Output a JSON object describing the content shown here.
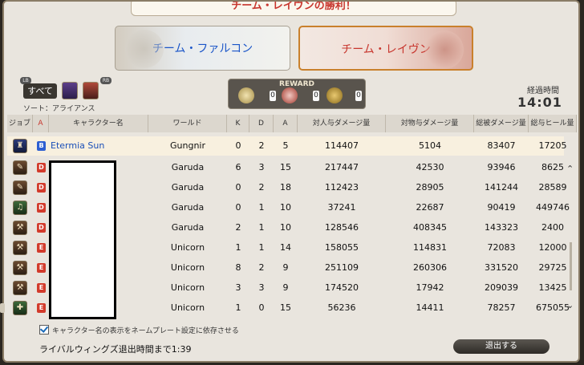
{
  "banner": {
    "title": "チーム・レイヴンの勝利！"
  },
  "teams": {
    "falcon": "チーム・ファルコン",
    "raven": "チーム・レイヴン"
  },
  "filter": {
    "lb": "LB",
    "rb": "RB",
    "all": "すべて",
    "sort": "ソート：アライアンス"
  },
  "reward": {
    "title": "REWARD",
    "values": [
      "0",
      "0",
      "0"
    ]
  },
  "elapsed": {
    "label": "経過時間",
    "time": "14:01"
  },
  "table": {
    "headers": [
      "ジョブ",
      "A",
      "キャラクター名",
      "ワールド",
      "K",
      "D",
      "A",
      "対人与ダメージ量",
      "対物与ダメージ量",
      "総被ダメージ量",
      "総与ヒール量"
    ],
    "rows": [
      {
        "team": "B",
        "name": "Etermia Sun",
        "world": "Gungnir",
        "k": "0",
        "d": "2",
        "a": "5",
        "pvp": "114407",
        "obj": "5104",
        "taken": "83407",
        "heal": "17205"
      },
      {
        "team": "D",
        "name": "",
        "world": "Garuda",
        "k": "6",
        "d": "3",
        "a": "15",
        "pvp": "217447",
        "obj": "42530",
        "taken": "93946",
        "heal": "8625"
      },
      {
        "team": "D",
        "name": "",
        "world": "Garuda",
        "k": "0",
        "d": "2",
        "a": "18",
        "pvp": "112423",
        "obj": "28905",
        "taken": "141244",
        "heal": "28589"
      },
      {
        "team": "D",
        "name": "",
        "world": "Garuda",
        "k": "0",
        "d": "1",
        "a": "10",
        "pvp": "37241",
        "obj": "22687",
        "taken": "90419",
        "heal": "449746"
      },
      {
        "team": "D",
        "name": "",
        "world": "Garuda",
        "k": "2",
        "d": "1",
        "a": "10",
        "pvp": "128546",
        "obj": "408345",
        "taken": "143323",
        "heal": "2400"
      },
      {
        "team": "E",
        "name": "",
        "world": "Unicorn",
        "k": "1",
        "d": "1",
        "a": "14",
        "pvp": "158055",
        "obj": "114831",
        "taken": "72083",
        "heal": "12000"
      },
      {
        "team": "E",
        "name": "",
        "world": "Unicorn",
        "k": "8",
        "d": "2",
        "a": "9",
        "pvp": "251109",
        "obj": "260306",
        "taken": "331520",
        "heal": "29725"
      },
      {
        "team": "E",
        "name": "",
        "world": "Unicorn",
        "k": "3",
        "d": "3",
        "a": "9",
        "pvp": "174520",
        "obj": "17942",
        "taken": "209039",
        "heal": "13425"
      },
      {
        "team": "E",
        "name": "",
        "world": "Unicorn",
        "k": "1",
        "d": "0",
        "a": "15",
        "pvp": "56236",
        "obj": "14411",
        "taken": "78257",
        "heal": "675055"
      }
    ]
  },
  "footer": {
    "checkbox_label": "キャラクター名の表示をネームプレート設定に依存させる",
    "timer": "ライバルウィングズ退出時間まで1:39",
    "exit": "退出する"
  }
}
